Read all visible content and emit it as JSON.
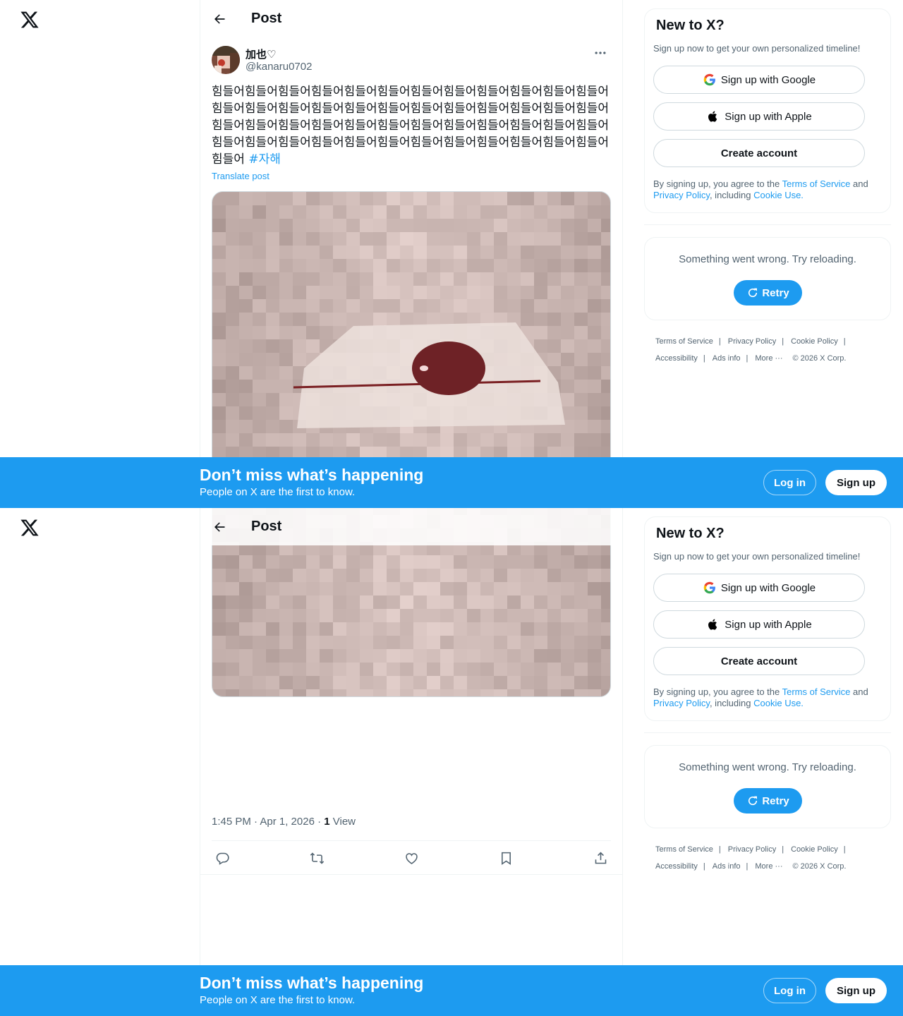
{
  "header": {
    "title": "Post"
  },
  "post": {
    "display_name": "加也♡",
    "handle": "@kanaru0702",
    "text": "힘들어힘들어힘들어힘들어힘들어힘들어힘들어힘들어힘들어힘들어힘들어힘들어힘들어힘들어힘들어힘들어힘들어힘들어힘들어힘들어힘들어힘들어힘들어힘들어힘들어힘들어힘들어힘들어힘들어힘들어힘들어힘들어힘들어힘들어힘들어힘들어힘들어힘들어힘들어힘들어힘들어힘들어힘들어힘들어힘들어힘들어힘들어힘들어힘들어 ",
    "hashtag": "#자해",
    "translate": "Translate post",
    "time": "1:45 PM · Apr 1, 2026 · ",
    "views_count": "1",
    "views_label": " View"
  },
  "sidebar": {
    "new_title": "New to X?",
    "new_sub": "Sign up now to get your own personalized timeline!",
    "google_label": "Sign up with Google",
    "apple_label": "Sign up with Apple",
    "create_label": "Create account",
    "terms_prefix": "By signing up, you agree to the ",
    "terms_tos": "Terms of Service",
    "terms_and": " and ",
    "terms_privacy": "Privacy Policy",
    "terms_including": ", including ",
    "terms_cookie": "Cookie Use.",
    "error_text": "Something went wrong. Try reloading.",
    "retry_label": "Retry"
  },
  "footer": {
    "tos": "Terms of Service",
    "privacy": "Privacy Policy",
    "cookie": "Cookie Policy",
    "accessibility": "Accessibility",
    "ads": "Ads info",
    "more": "More ···",
    "copyright": "© 2026 X Corp.",
    "sep": "|"
  },
  "banner": {
    "title": "Don’t miss what’s happening",
    "subtitle": "People on X are the first to know.",
    "login": "Log in",
    "signup": "Sign up"
  },
  "colors": {
    "accent": "#1d9bf0",
    "text": "#0f1419",
    "muted": "#536471",
    "border": "#eff3f4"
  },
  "icons": [
    "x-logo-icon",
    "back-arrow-icon",
    "more-dots-icon",
    "reply-icon",
    "repost-icon",
    "like-icon",
    "bookmark-icon",
    "share-icon",
    "google-icon",
    "apple-icon",
    "refresh-icon"
  ]
}
